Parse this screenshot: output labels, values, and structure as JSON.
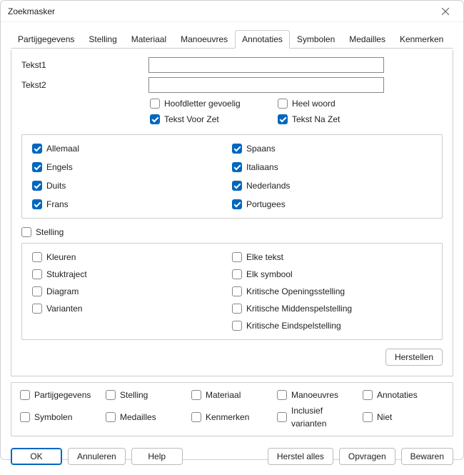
{
  "window": {
    "title": "Zoekmasker"
  },
  "tabs": {
    "items": [
      "Partijgegevens",
      "Stelling",
      "Materiaal",
      "Manoeuvres",
      "Annotaties",
      "Symbolen",
      "Medailles",
      "Kenmerken"
    ],
    "active_index": 4
  },
  "text_search": {
    "label1": "Tekst1",
    "label2": "Tekst2",
    "value1": "",
    "value2": "",
    "case_label": "Hoofdletter gevoelig",
    "case_checked": false,
    "whole_label": "Heel woord",
    "whole_checked": false,
    "before_label": "Tekst Voor Zet",
    "before_checked": true,
    "after_label": "Tekst Na Zet",
    "after_checked": true
  },
  "languages": {
    "left": [
      {
        "label": "Allemaal",
        "checked": true
      },
      {
        "label": "Engels",
        "checked": true
      },
      {
        "label": "Duits",
        "checked": true
      },
      {
        "label": "Frans",
        "checked": true
      }
    ],
    "right": [
      {
        "label": "Spaans",
        "checked": true
      },
      {
        "label": "Italiaans",
        "checked": true
      },
      {
        "label": "Nederlands",
        "checked": true
      },
      {
        "label": "Portugees",
        "checked": true
      }
    ]
  },
  "position_label": "Stelling",
  "position_checked": false,
  "flags": {
    "left": [
      {
        "label": "Kleuren",
        "checked": false
      },
      {
        "label": "Stuktraject",
        "checked": false
      },
      {
        "label": "Diagram",
        "checked": false
      },
      {
        "label": "Varianten",
        "checked": false
      }
    ],
    "right": [
      {
        "label": "Elke tekst",
        "checked": false
      },
      {
        "label": "Elk symbool",
        "checked": false
      },
      {
        "label": "Kritische Openingsstelling",
        "checked": false
      },
      {
        "label": "Kritische Middenspelstelling",
        "checked": false
      },
      {
        "label": "Kritische Eindspelstelling",
        "checked": false
      }
    ]
  },
  "restore_button": "Herstellen",
  "filter_row": [
    {
      "label": "Partijgegevens",
      "checked": false
    },
    {
      "label": "Stelling",
      "checked": false
    },
    {
      "label": "Materiaal",
      "checked": false
    },
    {
      "label": "Manoeuvres",
      "checked": false
    },
    {
      "label": "Annotaties",
      "checked": false
    },
    {
      "label": "Symbolen",
      "checked": false
    },
    {
      "label": "Medailles",
      "checked": false
    },
    {
      "label": "Kenmerken",
      "checked": false
    },
    {
      "label": "Inclusief varianten",
      "checked": false
    },
    {
      "label": "Niet",
      "checked": false
    }
  ],
  "footer": {
    "ok": "OK",
    "cancel": "Annuleren",
    "help": "Help",
    "reset_all": "Herstel alles",
    "query": "Opvragen",
    "save": "Bewaren"
  }
}
